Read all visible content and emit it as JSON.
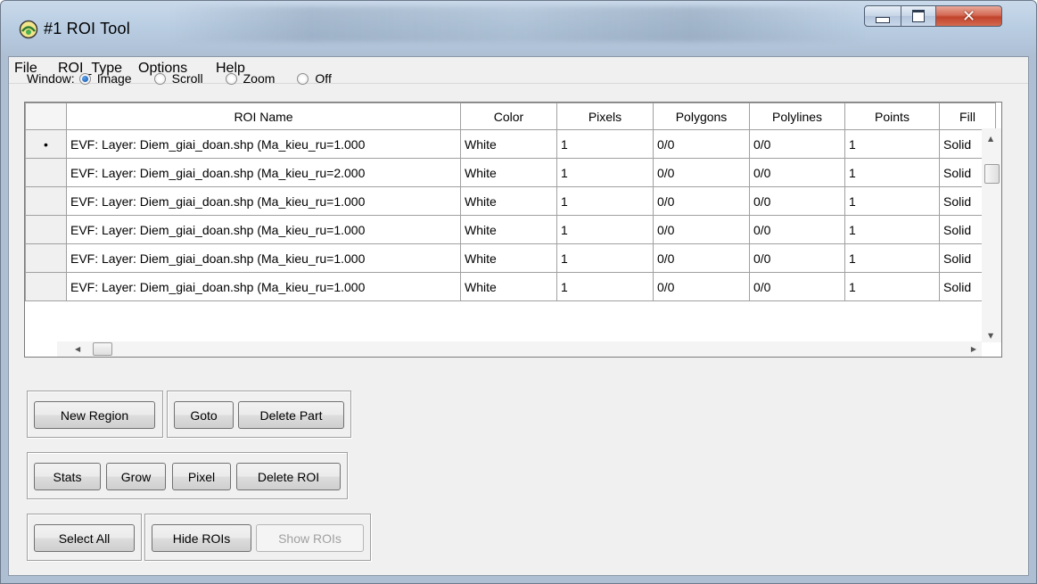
{
  "window": {
    "title": "#1 ROI Tool"
  },
  "menu": [
    "File",
    "ROI_Type",
    "Options",
    "Help"
  ],
  "window_mode": {
    "label": "Window:",
    "options": [
      "Image",
      "Scroll",
      "Zoom",
      "Off"
    ],
    "selected": "Image"
  },
  "table": {
    "columns": [
      "ROI Name",
      "Color",
      "Pixels",
      "Polygons",
      "Polylines",
      "Points",
      "Fill"
    ],
    "current_row_marker": "•",
    "rows": [
      [
        "EVF: Layer: Diem_giai_doan.shp (Ma_kieu_ru=1.000",
        "White",
        "1",
        "0/0",
        "0/0",
        "1",
        "Solid"
      ],
      [
        "EVF: Layer: Diem_giai_doan.shp (Ma_kieu_ru=2.000",
        "White",
        "1",
        "0/0",
        "0/0",
        "1",
        "Solid"
      ],
      [
        "EVF: Layer: Diem_giai_doan.shp (Ma_kieu_ru=1.000",
        "White",
        "1",
        "0/0",
        "0/0",
        "1",
        "Solid"
      ],
      [
        "EVF: Layer: Diem_giai_doan.shp (Ma_kieu_ru=1.000",
        "White",
        "1",
        "0/0",
        "0/0",
        "1",
        "Solid"
      ],
      [
        "EVF: Layer: Diem_giai_doan.shp (Ma_kieu_ru=1.000",
        "White",
        "1",
        "0/0",
        "0/0",
        "1",
        "Solid"
      ],
      [
        "EVF: Layer: Diem_giai_doan.shp (Ma_kieu_ru=1.000",
        "White",
        "1",
        "0/0",
        "0/0",
        "1",
        "Solid"
      ]
    ]
  },
  "buttons": {
    "new_region": "New Region",
    "goto": "Goto",
    "delete_part": "Delete Part",
    "stats": "Stats",
    "grow": "Grow",
    "pixel": "Pixel",
    "delete_roi": "Delete ROI",
    "select_all": "Select All",
    "hide_rois": "Hide ROIs",
    "show_rois": "Show ROIs"
  },
  "icons": {
    "app": "roi-tool-app-icon",
    "minimize": "minimize-icon",
    "maximize": "maximize-icon",
    "close": "close-icon"
  }
}
